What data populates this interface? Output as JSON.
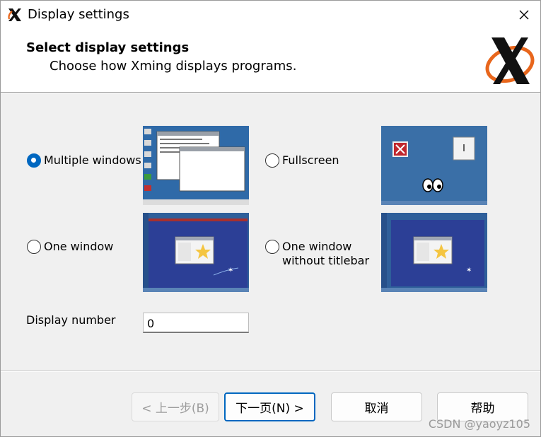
{
  "window": {
    "title": "Display settings",
    "icon": "xming-x-icon"
  },
  "header": {
    "title": "Select display settings",
    "subtitle": "Choose how Xming displays programs.",
    "logo": "xming-logo"
  },
  "options": [
    {
      "label": "Multiple windows",
      "selected": true
    },
    {
      "label": "Fullscreen",
      "selected": false
    },
    {
      "label": "One window",
      "selected": false
    },
    {
      "label": "One window",
      "label2": "without titlebar",
      "selected": false
    }
  ],
  "display_number": {
    "label": "Display number",
    "value": "0"
  },
  "buttons": {
    "back": "< 上一步(B)",
    "next": "下一页(N) >",
    "cancel": "取消",
    "help": "帮助"
  },
  "watermark": "CSDN @yaoyz105",
  "colors": {
    "accent": "#0067c0",
    "desktop_blue": "#3a6fa7",
    "panel": "#f0f0f0"
  }
}
